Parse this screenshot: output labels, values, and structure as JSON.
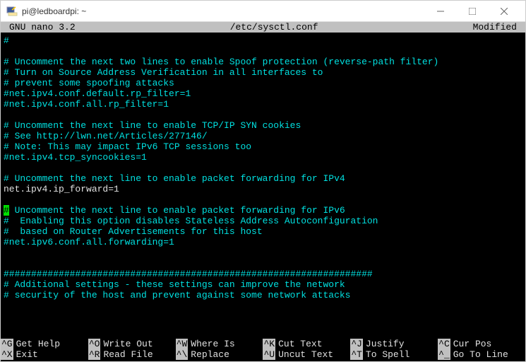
{
  "window": {
    "title": "pi@ledboardpi: ~"
  },
  "nano": {
    "app": "GNU nano 3.2",
    "file": "/etc/sysctl.conf",
    "status": "Modified"
  },
  "lines": [
    {
      "t": "#",
      "c": "comment"
    },
    {
      "t": "",
      "c": "comment"
    },
    {
      "t": "# Uncomment the next two lines to enable Spoof protection (reverse-path filter)",
      "c": "comment"
    },
    {
      "t": "# Turn on Source Address Verification in all interfaces to",
      "c": "comment"
    },
    {
      "t": "# prevent some spoofing attacks",
      "c": "comment"
    },
    {
      "t": "#net.ipv4.conf.default.rp_filter=1",
      "c": "comment"
    },
    {
      "t": "#net.ipv4.conf.all.rp_filter=1",
      "c": "comment"
    },
    {
      "t": "",
      "c": "comment"
    },
    {
      "t": "# Uncomment the next line to enable TCP/IP SYN cookies",
      "c": "comment"
    },
    {
      "t": "# See http://lwn.net/Articles/277146/",
      "c": "comment"
    },
    {
      "t": "# Note: This may impact IPv6 TCP sessions too",
      "c": "comment"
    },
    {
      "t": "#net.ipv4.tcp_syncookies=1",
      "c": "comment"
    },
    {
      "t": "",
      "c": "comment"
    },
    {
      "t": "# Uncomment the next line to enable packet forwarding for IPv4",
      "c": "comment"
    },
    {
      "t": "net.ipv4.ip_forward=1",
      "c": "active"
    },
    {
      "t": "",
      "c": "comment"
    },
    {
      "t": "#",
      "c": "comment",
      "cursor": true,
      "rest": " Uncomment the next line to enable packet forwarding for IPv6"
    },
    {
      "t": "#  Enabling this option disables Stateless Address Autoconfiguration",
      "c": "comment"
    },
    {
      "t": "#  based on Router Advertisements for this host",
      "c": "comment"
    },
    {
      "t": "#net.ipv6.conf.all.forwarding=1",
      "c": "comment"
    },
    {
      "t": "",
      "c": "comment"
    },
    {
      "t": "",
      "c": "comment"
    },
    {
      "t": "###################################################################",
      "c": "comment"
    },
    {
      "t": "# Additional settings - these settings can improve the network",
      "c": "comment"
    },
    {
      "t": "# security of the host and prevent against some network attacks",
      "c": "comment"
    }
  ],
  "footer": [
    [
      {
        "k": "^G",
        "l": "Get Help"
      },
      {
        "k": "^O",
        "l": "Write Out"
      },
      {
        "k": "^W",
        "l": "Where Is"
      },
      {
        "k": "^K",
        "l": "Cut Text"
      },
      {
        "k": "^J",
        "l": "Justify"
      },
      {
        "k": "^C",
        "l": "Cur Pos"
      }
    ],
    [
      {
        "k": "^X",
        "l": "Exit"
      },
      {
        "k": "^R",
        "l": "Read File"
      },
      {
        "k": "^\\",
        "l": "Replace"
      },
      {
        "k": "^U",
        "l": "Uncut Text"
      },
      {
        "k": "^T",
        "l": "To Spell"
      },
      {
        "k": "^_",
        "l": "Go To Line"
      }
    ]
  ]
}
